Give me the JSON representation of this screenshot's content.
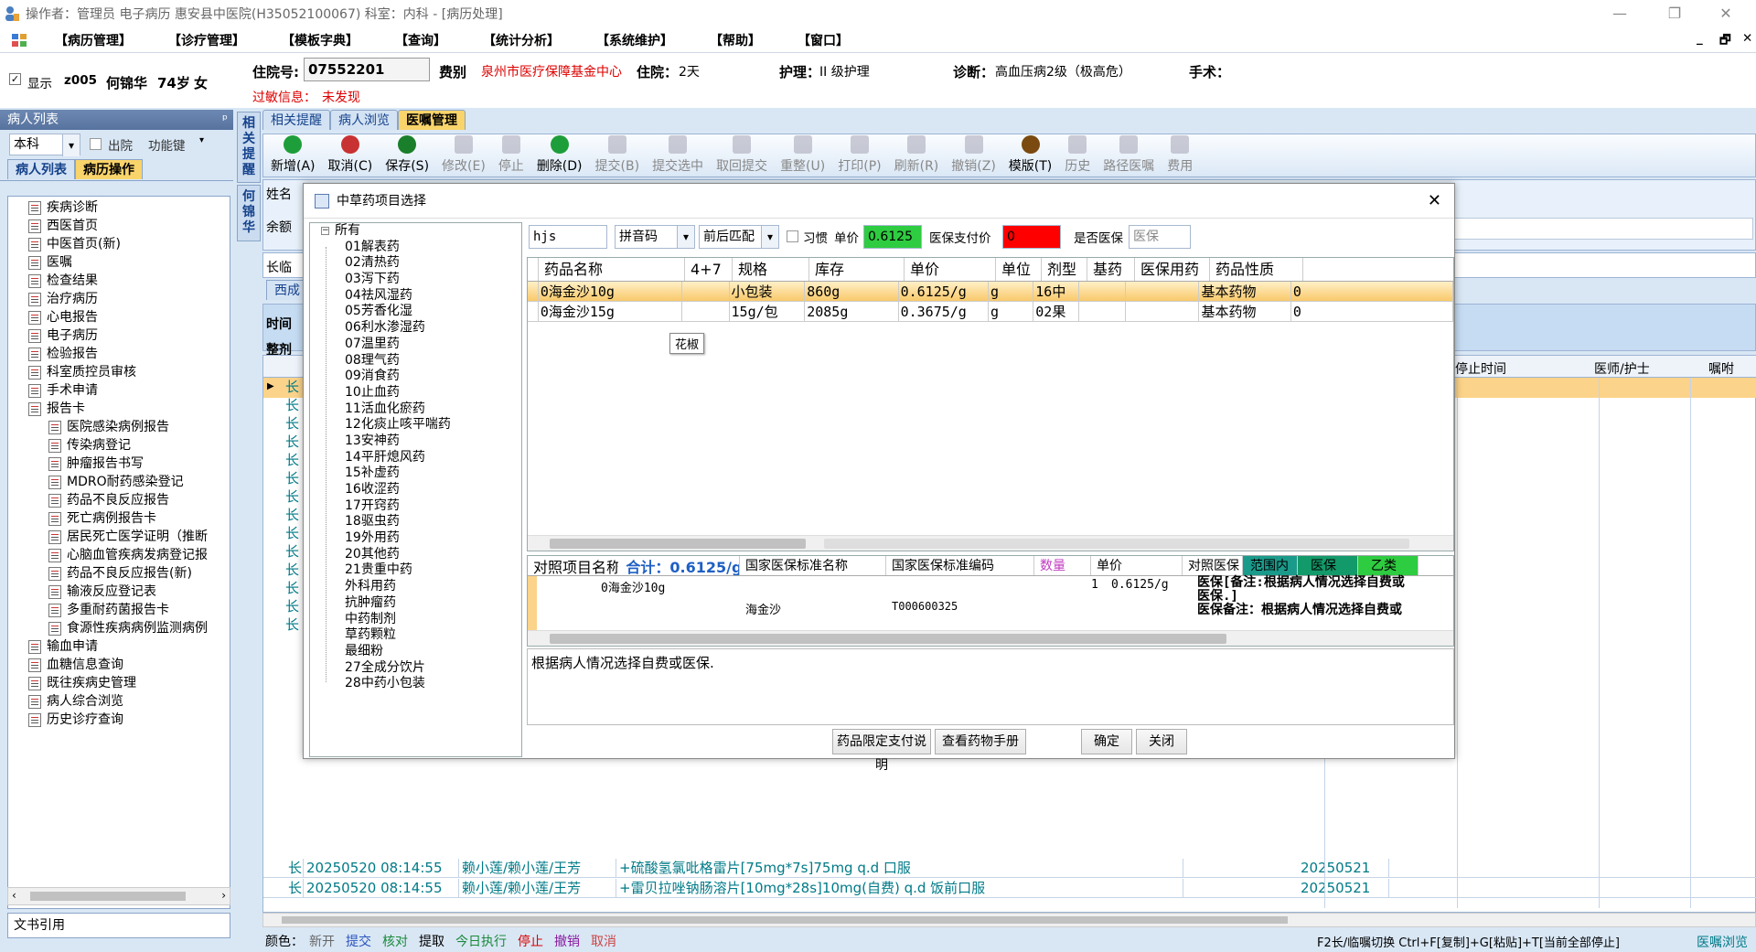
{
  "titlebar": {
    "text": "操作者：管理员 电子病历 惠安县中医院(H35052100067) 科室：内科 - [病历处理]"
  },
  "menu": [
    "【病历管理】",
    "【诊疗管理】",
    "【模板字典】",
    "【查询】",
    "【统计分析】",
    "【系统维护】",
    "【帮助】",
    "【窗口】"
  ],
  "patient": {
    "show_label": "显示",
    "bed": "z005",
    "name": "何锦华",
    "age": "74岁",
    "sex": "女",
    "admission_label": "住院号:",
    "admission_no": "07552201",
    "fee_label": "费别",
    "fee_value": "泉州市医疗保障基金中心",
    "stay_label": "住院：",
    "stay_value": "2天",
    "nursing_label": "护理：",
    "nursing_value": "II 级护理",
    "diag_label": "诊断：",
    "diag_value": "高血压病2级（极高危）",
    "surgery_label": "手术：",
    "allergy_label": "过敏信息：",
    "allergy_value": "未发现"
  },
  "sidebar": {
    "header": "病人列表",
    "pin": "ᵖ",
    "dept": "本科",
    "discharge": "出院",
    "func_key": "功能键",
    "tabs": [
      "病人列表",
      "病历操作"
    ],
    "items": [
      {
        "label": "疾病诊断",
        "indent": 1
      },
      {
        "label": "西医首页",
        "indent": 1
      },
      {
        "label": "中医首页(新)",
        "indent": 1
      },
      {
        "label": "医嘱",
        "indent": 1
      },
      {
        "label": "检查结果",
        "indent": 1
      },
      {
        "label": "治疗病历",
        "indent": 1
      },
      {
        "label": "心电报告",
        "indent": 1
      },
      {
        "label": "电子病历",
        "indent": 1
      },
      {
        "label": "检验报告",
        "indent": 1
      },
      {
        "label": "科室质控员审核",
        "indent": 1
      },
      {
        "label": "手术申请",
        "indent": 1
      },
      {
        "label": "报告卡",
        "indent": 1
      },
      {
        "label": "医院感染病例报告",
        "indent": 2
      },
      {
        "label": "传染病登记",
        "indent": 2
      },
      {
        "label": "肿瘤报告书写",
        "indent": 2
      },
      {
        "label": "MDRO耐药感染登记",
        "indent": 2
      },
      {
        "label": "药品不良反应报告",
        "indent": 2
      },
      {
        "label": "死亡病例报告卡",
        "indent": 2
      },
      {
        "label": "居民死亡医学证明（推断",
        "indent": 2
      },
      {
        "label": "心脑血管疾病发病登记报",
        "indent": 2
      },
      {
        "label": "药品不良反应报告(新)",
        "indent": 2
      },
      {
        "label": "输液反应登记表",
        "indent": 2
      },
      {
        "label": "多重耐药菌报告卡",
        "indent": 2
      },
      {
        "label": "食源性疾病病例监测病例",
        "indent": 2
      },
      {
        "label": "输血申请",
        "indent": 1
      },
      {
        "label": "血糖信息查询",
        "indent": 1
      },
      {
        "label": "既往疾病史管理",
        "indent": 1
      },
      {
        "label": "病人综合浏览",
        "indent": 1
      },
      {
        "label": "历史诊疗查询",
        "indent": 1
      }
    ],
    "footer": "文书引用"
  },
  "vtabs": {
    "tab1": "相关提醒",
    "tab2": "何锦华"
  },
  "main": {
    "tabs": [
      "相关提醒",
      "病人浏览",
      "医嘱管理"
    ],
    "toolbar": [
      {
        "label": "新增(A)",
        "icon": "add-icon",
        "enabled": true,
        "color": "#1e9e3a"
      },
      {
        "label": "取消(C)",
        "icon": "undo-icon",
        "enabled": true,
        "color": "#c83232"
      },
      {
        "label": "保存(S)",
        "icon": "save-icon",
        "enabled": true,
        "color": "#1a7f2a"
      },
      {
        "label": "修改(E)",
        "icon": "edit-icon",
        "enabled": false
      },
      {
        "label": "停止",
        "icon": "stop-icon",
        "enabled": false
      },
      {
        "label": "删除(D)",
        "icon": "delete-icon",
        "enabled": true,
        "color": "#1e9e3a"
      },
      {
        "label": "提交(B)",
        "icon": "submit-icon",
        "enabled": false
      },
      {
        "label": "提交选中",
        "icon": "submit-selected-icon",
        "enabled": false
      },
      {
        "label": "取回提交",
        "icon": "retrieve-icon",
        "enabled": false
      },
      {
        "label": "重整(U)",
        "icon": "reorganize-icon",
        "enabled": false
      },
      {
        "label": "打印(P)",
        "icon": "print-icon",
        "enabled": false
      },
      {
        "label": "刷新(R)",
        "icon": "refresh-icon",
        "enabled": false
      },
      {
        "label": "撤销(Z)",
        "icon": "revoke-icon",
        "enabled": false
      },
      {
        "label": "模版(T)",
        "icon": "template-icon",
        "enabled": true,
        "color": "#7a4a10"
      },
      {
        "label": "历史",
        "icon": "history-icon",
        "enabled": false
      },
      {
        "label": "路径医嘱",
        "icon": "pathway-icon",
        "enabled": false
      },
      {
        "label": "费用",
        "icon": "cost-icon",
        "enabled": false
      }
    ],
    "side_labels": [
      "姓名",
      "余额",
      "长临",
      "西成",
      "时间",
      "整剂"
    ],
    "grid_headers": {
      "stop_time": "停止时间",
      "doctor_nurse": "医师/护士",
      "note": "嘱咐"
    },
    "orders": [
      {
        "type": "长",
        "time": "20250520 08:14:55",
        "doctor": "赖小莲/赖小莲/王芳",
        "content": "+硫酸氢氯吡格雷片[75mg*7s]75mg q.d 口服",
        "date": "20250521"
      },
      {
        "type": "长",
        "time": "20250520 08:14:55",
        "doctor": "赖小莲/赖小莲/王芳",
        "content": "+雷贝拉唑钠肠溶片[10mg*28s]10mg(自费) q.d 饭前口服",
        "date": "20250521"
      }
    ],
    "long_mark": "长"
  },
  "dialog": {
    "title": "中草药项目选择",
    "tree_root": "所有",
    "tree": [
      "01解表药",
      "02清热药",
      "03泻下药",
      "04祛风湿药",
      "05芳香化湿",
      "06利水渗湿药",
      "07温里药",
      "08理气药",
      "09消食药",
      "10止血药",
      "11活血化瘀药",
      "12化痰止咳平喘药",
      "13安神药",
      "14平肝熄风药",
      "15补虚药",
      "16收涩药",
      "17开窍药",
      "18驱虫药",
      "19外用药",
      "20其他药",
      "21贵重中药",
      "外科用药",
      "抗肿瘤药",
      "中药制剂",
      "草药颗粒",
      "最细粉",
      "27全成分饮片",
      "28中药小包装"
    ],
    "search_value": "hjs",
    "code_type": "拼音码",
    "match_mode": "前后匹配",
    "habit_label": "习惯",
    "price_label": "单价",
    "price_value": "0.6125",
    "ins_pay_label": "医保支付价",
    "ins_pay_value": "0",
    "is_ins_label": "是否医保",
    "is_ins_value": "医保",
    "headers": [
      "药品名称",
      "4+7",
      "规格",
      "库存",
      "单价",
      "单位",
      "剂型",
      "基药",
      "医保用药",
      "药品性质"
    ],
    "rows": [
      [
        "0海金沙10g",
        "",
        "小包装",
        "860g",
        "0.6125/g",
        "g",
        "16中",
        "",
        "",
        "基本药物",
        "0"
      ],
      [
        "0海金沙15g",
        "",
        "15g/包",
        "2085g",
        "0.3675/g",
        "g",
        "02果",
        "",
        "",
        "基本药物",
        "0"
      ]
    ],
    "tooltip": "花椒",
    "lower": {
      "h1": "对照项目名称",
      "total_label": "合计：0.6125/g",
      "h2": "国家医保标准名称",
      "h3": "国家医保标准编码",
      "h4": "数量",
      "h5": "单价",
      "h6": "对照医保",
      "badge1": "范围内",
      "badge2": "医保",
      "badge3": "乙类",
      "item": "0海金沙10g",
      "std_name": "海金沙",
      "std_code": "T000600325",
      "qty": "1",
      "price": "0.6125/g",
      "remark1": "医保[备注:根据病人情况选择自费或",
      "remark2": "医保.]",
      "remark3": "医保备注：根据病人情况选择自费或"
    },
    "note": "根据病人情况选择自费或医保.",
    "buttons": {
      "limit": "药品限定支付说明",
      "manual": "查看药物手册",
      "ok": "确定",
      "close": "关闭"
    }
  },
  "status": {
    "color_label": "颜色：",
    "new": "新开",
    "submit": "提交",
    "check": "核对",
    "fetch": "提取",
    "today": "今日执行",
    "stop": "停止",
    "undo": "撤销",
    "cancel": "取消",
    "hint": "F2长/临嘱切换 Ctrl+F[复制]+G[粘贴]+T[当前全部停止]",
    "browse": "医嘱浏览"
  }
}
